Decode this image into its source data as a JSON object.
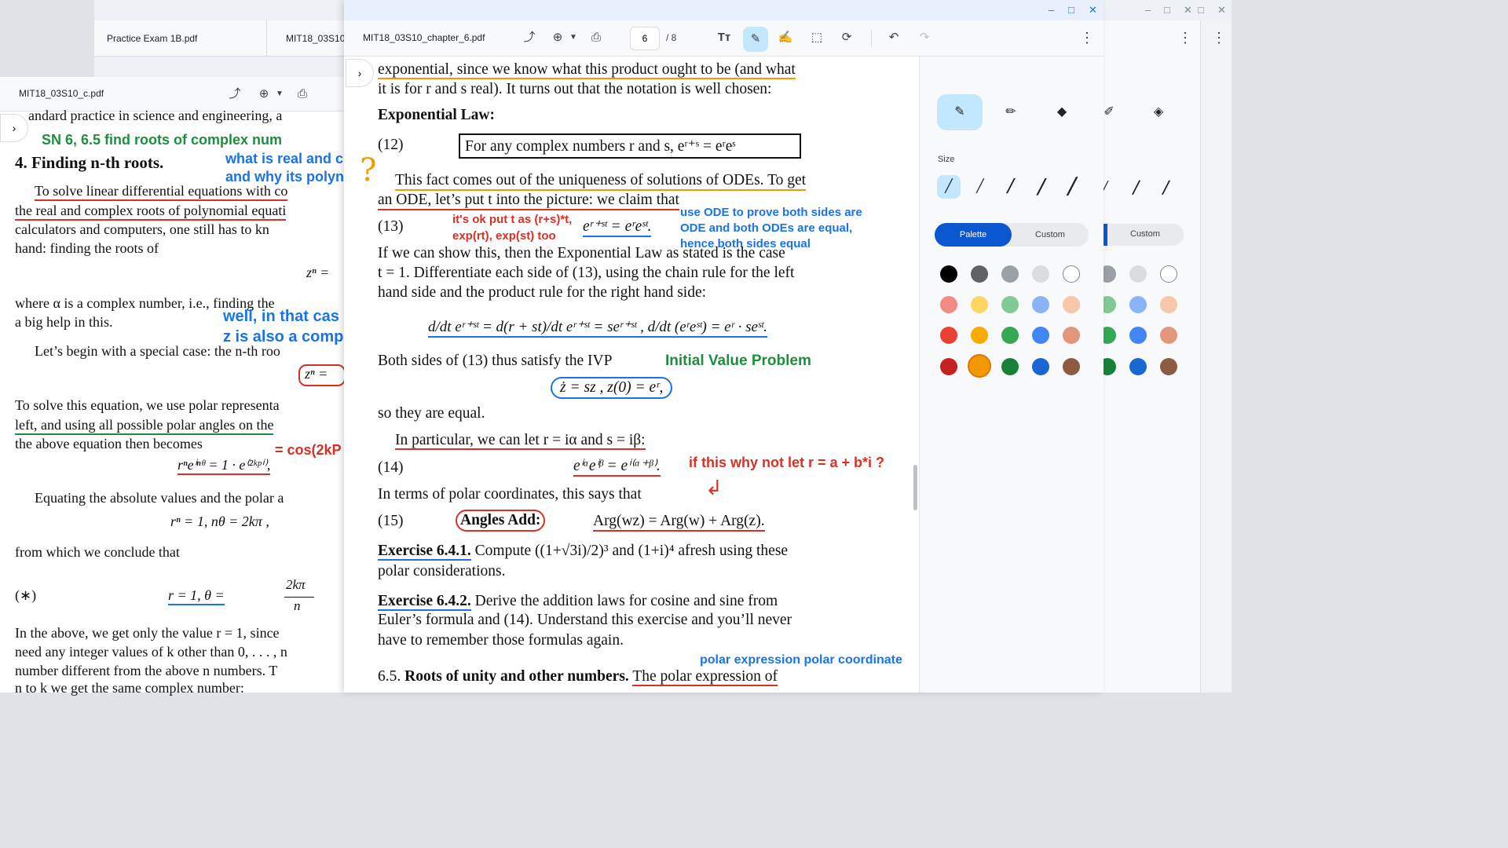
{
  "back_window": {
    "tabs": [
      "Practice Exam 1B.pdf",
      "MIT18_03S10_"
    ],
    "controls": [
      "–",
      "□",
      "✕"
    ]
  },
  "mid_window": {
    "filename": "MIT18_03S10_c.pdf",
    "lines": [
      "andard practice in science and engineering, a",
      "4. Finding n-th roots.",
      "To solve linear differential equations with co",
      "the real and complex roots of polynomial equati",
      "calculators and computers, one still has to kn",
      "hand: finding the roots of",
      "zⁿ =",
      "where α is a complex number, i.e., finding the",
      "a big help in this.",
      "Let’s begin with a special case: the n-th roo",
      "zⁿ =",
      "To solve this equation, we use polar representa",
      "left, and using all possible polar angles on the",
      "the above equation then becomes",
      "rⁿeⁱⁿᶿ = 1 · e⁽²ᵏᵖⁱ⁾,",
      "Equating the absolute values and the polar a",
      "rⁿ = 1,      nθ = 2kπ ,",
      "from which we conclude that",
      "(∗)",
      "r = 1,     θ =",
      "2kπ",
      "n",
      "In the above, we get only the value r = 1, since",
      "need any integer values of k other than 0, . . . , n",
      "number different from the above n numbers. T",
      "n  to k  we get the same complex number:"
    ],
    "notes": [
      "SN 6, 6.5 find roots of complex num",
      "what is real and c",
      "and why its polyn",
      "well, in that cas",
      "z is also a comp",
      "= cos(2kP"
    ]
  },
  "main_window": {
    "filename": "MIT18_03S10_chapter_6.pdf",
    "page_current": "6",
    "page_total": "/  8",
    "controls": [
      "–",
      "□",
      "✕"
    ]
  },
  "document": {
    "l1": "exponential, since we know what this product ought to be (and what",
    "l2": "it is for r and s real). It turns out that the notation is well chosen:",
    "heading": "Exponential Law:",
    "eq12_num": "(12)",
    "eq12": "For any complex numbers r and s, eʳ⁺ˢ = eʳeˢ",
    "p1a": "This fact comes out of the uniqueness of solutions of ODEs. To get",
    "p1b": "an ODE, let’s put t into the picture:  we claim that",
    "eq13_num": "(13)",
    "eq13": "eʳ⁺ˢᵗ = eʳeˢᵗ.",
    "p2a": "If we can show this, then the Exponential Law as stated is the case",
    "p2b": "t = 1.  Differentiate each side of (13), using the chain rule for the left",
    "p2c": "hand side and the product rule for the right hand side:",
    "deriv": "d/dt eʳ⁺ˢᵗ = d(r + st)/dt eʳ⁺ˢᵗ = seʳ⁺ˢᵗ ,    d/dt (eʳeˢᵗ) = eʳ · seˢᵗ.",
    "p3": "Both sides of (13) thus satisfy the IVP",
    "ivp": "ż = sz ,    z(0) = eʳ,",
    "p4": "so they are equal.",
    "p5": "In particular, we can let r = iα and s = iβ:",
    "eq14_num": "(14)",
    "eq14": "eⁱᵅeⁱᵝ = eⁱ⁽ᵅ⁺ᵝ⁾.",
    "p6": "In terms of polar coordinates, this says that",
    "eq15_num": "(15)",
    "eq15_label": "Angles Add:",
    "eq15": "Arg(wz) = Arg(w) + Arg(z).",
    "ex1_label": "Exercise 6.4.1.",
    "ex1a": "Compute ((1+√3i)/2)³ and (1+i)⁴ afresh using these",
    "ex1b": "polar considerations.",
    "ex2_label": "Exercise 6.4.2.",
    "ex2a": "Derive the addition laws for cosine and sine from",
    "ex2b": "Euler’s formula and (14).  Understand this exercise and you’ll never",
    "ex2c": "have to remember those formulas again.",
    "sec_num": "6.5.",
    "sec_title": "Roots of unity and other numbers.",
    "sec_tail": "The polar expression of"
  },
  "annotations": {
    "note_t": "it's ok put t as (r+s)*t,",
    "note_t2": "exp(rt), exp(st) too",
    "note_ode1": "use ODE to prove both sides are",
    "note_ode2": "ODE and both ODEs are equal,",
    "note_ode3": "hence both sides equal",
    "note_ivp": "Initial Value Problem",
    "note_why": "if this why not let r = a + b*i ?",
    "note_polar": "polar expression polar coordinate",
    "qmark": "?"
  },
  "side_panel": {
    "size_label": "Size",
    "palette_tab": "Palette",
    "custom_tab": "Custom",
    "back_custom_tab": "Custom"
  },
  "colors": {
    "accent": "#1a73e8",
    "palette": [
      "#000000",
      "#5f6368",
      "#9aa0a6",
      "#dadce0",
      "#ffffff",
      "#f28b82",
      "#fdd663",
      "#81c995",
      "#8ab4f8",
      "#f6c7a8",
      "#e94235",
      "#f9ab00",
      "#34a853",
      "#4285f4",
      "#e2977c",
      "#c5221f",
      "#f29900",
      "#188038",
      "#1967d2",
      "#8d5b41"
    ]
  }
}
